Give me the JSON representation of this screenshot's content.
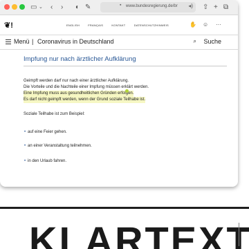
{
  "browser": {
    "url": "www.bundesregierung.de/br",
    "sidebar_icon": "sidebar-icon",
    "back_icon": "chevron-left-icon",
    "forward_icon": "chevron-right-icon"
  },
  "site_nav": {
    "links": [
      "ENGLISH",
      "FRANÇAIS",
      "KONTAKT",
      "DATENSCHUTZHINWEIS"
    ]
  },
  "menubar": {
    "menu_label": "Menü",
    "separator": "|",
    "breadcrumb": "Coronavirus in Deutschland",
    "search_label": "Suche"
  },
  "article": {
    "heading": "Impfung nur nach ärztlicher Aufklärung",
    "paragraphs": [
      "Geimpft werden darf nur nach einer ärztlicher Aufklärung.",
      "Die Vorteile und die Nachteile einer Impfung müssen erklärt werden.",
      "Eine Impfung muss aus gesundheitlichen Gründen erfolgen.",
      "Es darf nicht geimpft werden, wenn der Grund soziale Teilhabe ist."
    ],
    "example_intro": "Soziale Teilhabe ist zum Beispiel:",
    "bullets": [
      "auf eine Feier gehen.",
      "an einer Veranstaltung teilnehmen.",
      "in den Urlaub fahren."
    ],
    "highlight_color": "#f6f7c3",
    "heading_color": "#2a5896"
  },
  "banner": {
    "text": "KLARTEXT"
  }
}
